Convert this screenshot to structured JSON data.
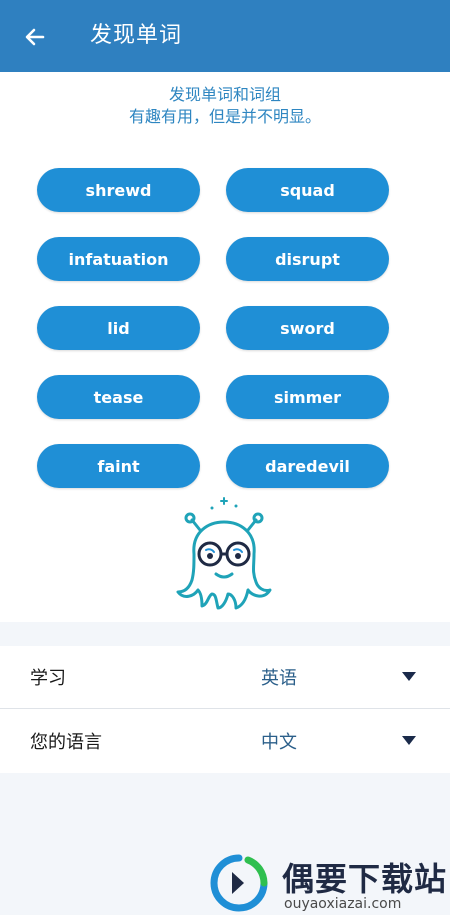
{
  "appbar": {
    "title": "发现单词",
    "back_icon": "arrow-left-icon"
  },
  "intro": {
    "line1": "发现单词和词组",
    "line2": "有趣有用，但是并不明显。"
  },
  "words": [
    "shrewd",
    "squad",
    "infatuation",
    "disrupt",
    "lid",
    "sword",
    "tease",
    "simmer",
    "faint",
    "daredevil"
  ],
  "mascot": {
    "icon": "octopus-with-glasses-icon"
  },
  "settings": {
    "learn": {
      "label": "学习",
      "value": "英语",
      "icon": "caret-down-icon"
    },
    "your_language": {
      "label": "您的语言",
      "value": "中文",
      "icon": "caret-down-icon"
    }
  },
  "watermark": {
    "title": "偶要下载站",
    "url": "ouyaoxiazai.com"
  },
  "colors": {
    "appbar": "#2f80c0",
    "chip": "#1f8fd6",
    "intro_text": "#2e86c1",
    "page_gray": "#f3f6fa"
  }
}
